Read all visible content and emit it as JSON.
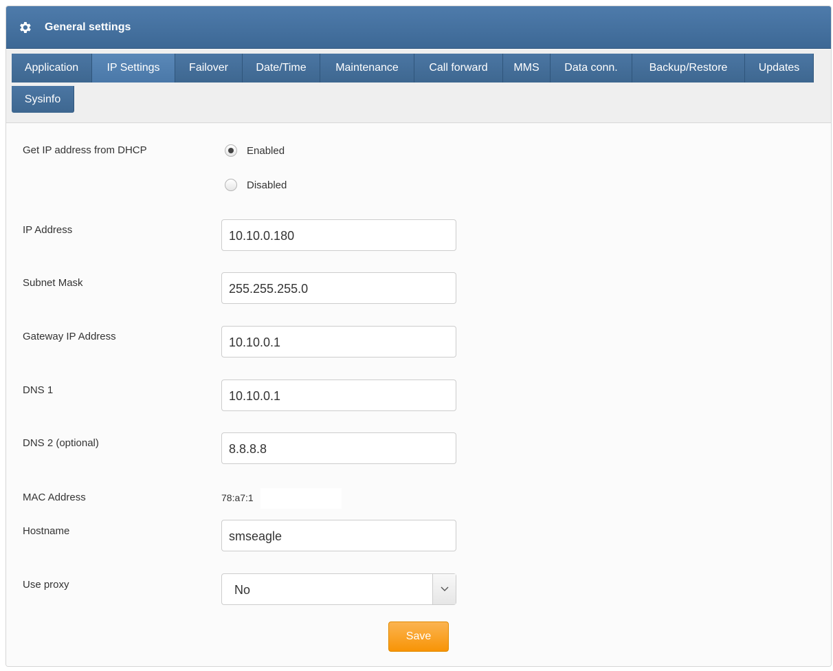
{
  "header": {
    "title": "General settings",
    "icon": "gear-icon"
  },
  "tabs": [
    {
      "label": "Application",
      "active": false
    },
    {
      "label": "IP Settings",
      "active": true
    },
    {
      "label": "Failover",
      "active": false
    },
    {
      "label": "Date/Time",
      "active": false
    },
    {
      "label": "Maintenance",
      "active": false
    },
    {
      "label": "Call forward",
      "active": false
    },
    {
      "label": "MMS",
      "active": false
    },
    {
      "label": "Data conn.",
      "active": false
    },
    {
      "label": "Backup/Restore",
      "active": false
    },
    {
      "label": "Updates",
      "active": false
    },
    {
      "label": "Sysinfo",
      "active": false
    }
  ],
  "form": {
    "dhcp": {
      "label": "Get IP address from DHCP",
      "options": [
        "Enabled",
        "Disabled"
      ],
      "selected": "Enabled"
    },
    "ip_address": {
      "label": "IP Address",
      "value": "10.10.0.180"
    },
    "subnet_mask": {
      "label": "Subnet Mask",
      "value": "255.255.255.0"
    },
    "gateway": {
      "label": "Gateway IP Address",
      "value": "10.10.0.1"
    },
    "dns1": {
      "label": "DNS 1",
      "value": "10.10.0.1"
    },
    "dns2": {
      "label": "DNS 2 (optional)",
      "value": "8.8.8.8"
    },
    "mac": {
      "label": "MAC Address",
      "value": "78:a7:1"
    },
    "hostname": {
      "label": "Hostname",
      "value": "smseagle"
    },
    "proxy": {
      "label": "Use proxy",
      "selected": "No"
    },
    "save_label": "Save"
  },
  "colors": {
    "header": "#3d6895",
    "tab": "#3e6790",
    "save": "#f89406"
  }
}
